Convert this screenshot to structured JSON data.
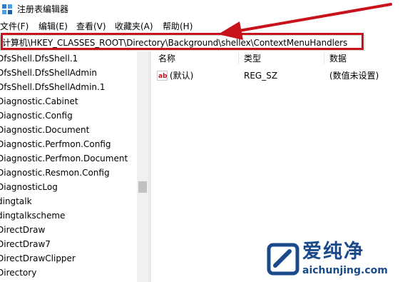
{
  "window": {
    "title": "注册表编辑器",
    "icon": "regedit-icon"
  },
  "menu": [
    "文件(F)",
    "编辑(E)",
    "查看(V)",
    "收藏夹(A)",
    "帮助(H)"
  ],
  "address": {
    "path": "计算机\\HKEY_CLASSES_ROOT\\Directory\\Background\\shellex\\ContextMenuHandlers"
  },
  "tree": {
    "items": [
      "DfsShell.DfsShell.1",
      "DfsShell.DfsShellAdmin",
      "DfsShell.DfsShellAdmin.1",
      "Diagnostic.Cabinet",
      "Diagnostic.Config",
      "Diagnostic.Document",
      "Diagnostic.Perfmon.Config",
      "Diagnostic.Perfmon.Document",
      "Diagnostic.Resmon.Config",
      "DiagnosticLog",
      "dingtalk",
      "dingtalkscheme",
      "DirectDraw",
      "DirectDraw7",
      "DirectDrawClipper",
      "Directory"
    ]
  },
  "list": {
    "columns": [
      "名称",
      "类型",
      "数据"
    ],
    "rows": [
      {
        "name": "(默认)",
        "type": "REG_SZ",
        "data": "(数值未设置)"
      }
    ]
  },
  "watermark": {
    "text": "爱纯净",
    "url": "aichunjing.com"
  },
  "colors": {
    "highlight": "#c8121b",
    "watermark": "#1a4a8a"
  }
}
